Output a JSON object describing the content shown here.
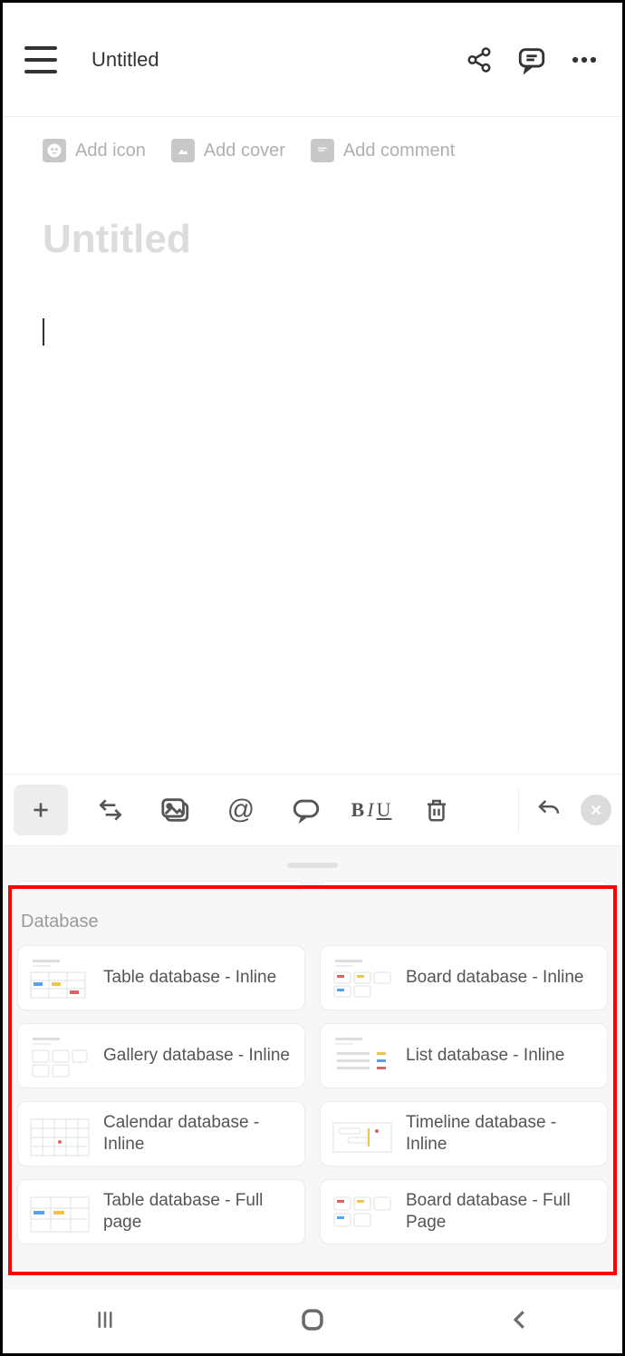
{
  "topbar": {
    "title": "Untitled"
  },
  "page_actions": {
    "add_icon": "Add icon",
    "add_cover": "Add cover",
    "add_comment": "Add comment"
  },
  "title_placeholder": "Untitled",
  "insert_menu": {
    "section": "Database",
    "items": [
      {
        "label": "Table database - Inline",
        "kind": "table"
      },
      {
        "label": "Board database - Inline",
        "kind": "board"
      },
      {
        "label": "Gallery database - Inline",
        "kind": "gallery"
      },
      {
        "label": "List database - Inline",
        "kind": "list"
      },
      {
        "label": "Calendar database - Inline",
        "kind": "calendar"
      },
      {
        "label": "Timeline database - Inline",
        "kind": "timeline"
      },
      {
        "label": "Table database - Full page",
        "kind": "table"
      },
      {
        "label": "Board database - Full Page",
        "kind": "board"
      }
    ]
  }
}
